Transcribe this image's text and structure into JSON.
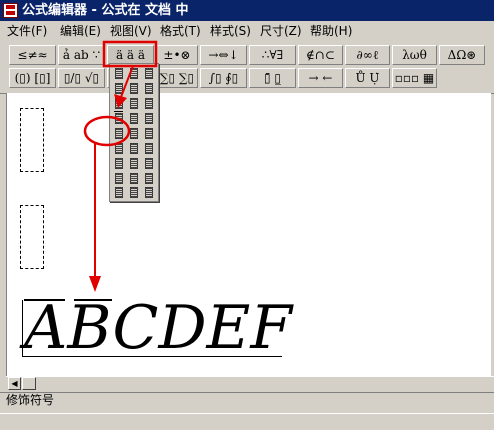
{
  "window": {
    "title": "公式编辑器 - 公式在 文档 中"
  },
  "menu": [
    {
      "label": "文件(F)"
    },
    {
      "label": "编辑(E)"
    },
    {
      "label": "视图(V)"
    },
    {
      "label": "格式(T)"
    },
    {
      "label": "样式(S)"
    },
    {
      "label": "尺寸(Z)"
    },
    {
      "label": "帮助(H)"
    }
  ],
  "toolbar_row1": [
    {
      "label": "≤≠≈",
      "icon": "relations-palette"
    },
    {
      "label": "ả ab ∵",
      "icon": "spaces-palette"
    },
    {
      "label": "ä ä ä",
      "icon": "embellishment-palette"
    },
    {
      "label": "±•⊗",
      "icon": "operators-palette"
    },
    {
      "label": "→⇔↓",
      "icon": "arrows-palette"
    },
    {
      "label": "∴∀∃",
      "icon": "logic-palette"
    },
    {
      "label": "∉∩⊂",
      "icon": "sets-palette"
    },
    {
      "label": "∂∞ℓ",
      "icon": "misc-symbols-palette"
    },
    {
      "label": "λωθ",
      "icon": "greek-lowercase-palette"
    },
    {
      "label": "ΔΩ⊛",
      "icon": "greek-uppercase-palette"
    }
  ],
  "toolbar_row2": [
    {
      "label": "(▯) [▯]",
      "icon": "fences-palette"
    },
    {
      "label": "▯/▯ √▯",
      "icon": "fractions-radicals-palette"
    },
    {
      "label": "",
      "icon": "subscript-palette"
    },
    {
      "label": "∑▯ ∑▯",
      "icon": "summation-palette"
    },
    {
      "label": "∫▯ ∮▯",
      "icon": "integrals-palette"
    },
    {
      "label": "▯̄ ▯̲",
      "icon": "underbar-overbar-palette"
    },
    {
      "label": "→ ←",
      "icon": "labeled-arrows-palette"
    },
    {
      "label": "Ů Ụ̇",
      "icon": "products-palette"
    },
    {
      "label": "▫▫▫ ▦",
      "icon": "matrices-palette"
    }
  ],
  "status": {
    "text": "修饰符号"
  }
}
